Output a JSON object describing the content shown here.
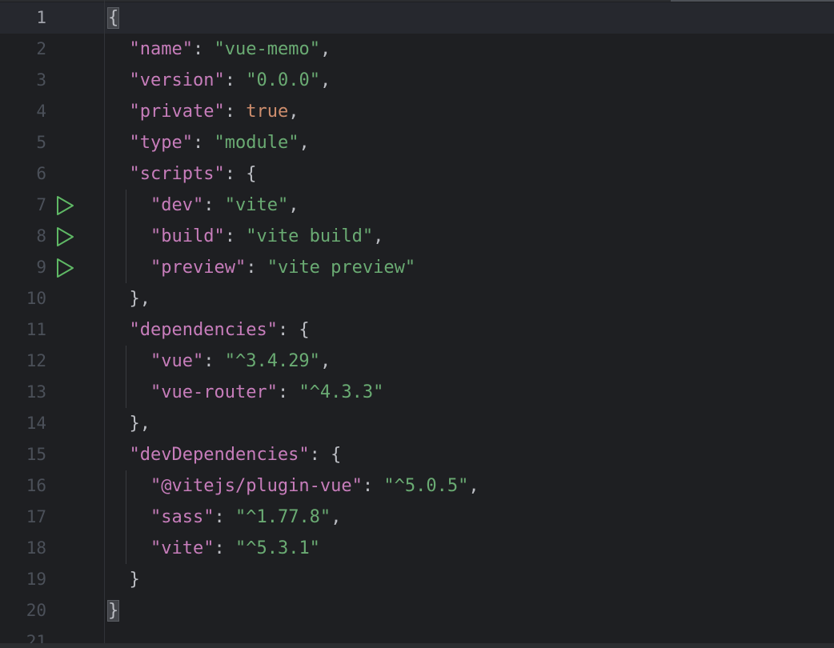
{
  "editor": {
    "active_line": 1,
    "lines": [
      {
        "n": "1",
        "tokens": [
          {
            "t": "brace",
            "v": "{"
          }
        ]
      },
      {
        "n": "2",
        "tokens": [
          {
            "t": "pun",
            "v": "  "
          },
          {
            "t": "key",
            "v": "\"name\""
          },
          {
            "t": "pun",
            "v": ": "
          },
          {
            "t": "str",
            "v": "\"vue-memo\""
          },
          {
            "t": "pun",
            "v": ","
          }
        ]
      },
      {
        "n": "3",
        "tokens": [
          {
            "t": "pun",
            "v": "  "
          },
          {
            "t": "key",
            "v": "\"version\""
          },
          {
            "t": "pun",
            "v": ": "
          },
          {
            "t": "str",
            "v": "\"0.0.0\""
          },
          {
            "t": "pun",
            "v": ","
          }
        ]
      },
      {
        "n": "4",
        "tokens": [
          {
            "t": "pun",
            "v": "  "
          },
          {
            "t": "key",
            "v": "\"private\""
          },
          {
            "t": "pun",
            "v": ": "
          },
          {
            "t": "kw",
            "v": "true"
          },
          {
            "t": "pun",
            "v": ","
          }
        ]
      },
      {
        "n": "5",
        "tokens": [
          {
            "t": "pun",
            "v": "  "
          },
          {
            "t": "key",
            "v": "\"type\""
          },
          {
            "t": "pun",
            "v": ": "
          },
          {
            "t": "str",
            "v": "\"module\""
          },
          {
            "t": "pun",
            "v": ","
          }
        ]
      },
      {
        "n": "6",
        "tokens": [
          {
            "t": "pun",
            "v": "  "
          },
          {
            "t": "key",
            "v": "\"scripts\""
          },
          {
            "t": "pun",
            "v": ": {"
          }
        ]
      },
      {
        "n": "7",
        "run": true,
        "tokens": [
          {
            "t": "pun",
            "v": "    "
          },
          {
            "t": "key",
            "v": "\"dev\""
          },
          {
            "t": "pun",
            "v": ": "
          },
          {
            "t": "str",
            "v": "\"vite\""
          },
          {
            "t": "pun",
            "v": ","
          }
        ]
      },
      {
        "n": "8",
        "run": true,
        "tokens": [
          {
            "t": "pun",
            "v": "    "
          },
          {
            "t": "key",
            "v": "\"build\""
          },
          {
            "t": "pun",
            "v": ": "
          },
          {
            "t": "str",
            "v": "\"vite build\""
          },
          {
            "t": "pun",
            "v": ","
          }
        ]
      },
      {
        "n": "9",
        "run": true,
        "tokens": [
          {
            "t": "pun",
            "v": "    "
          },
          {
            "t": "key",
            "v": "\"preview\""
          },
          {
            "t": "pun",
            "v": ": "
          },
          {
            "t": "str",
            "v": "\"vite preview\""
          }
        ]
      },
      {
        "n": "10",
        "tokens": [
          {
            "t": "pun",
            "v": "  },"
          }
        ]
      },
      {
        "n": "11",
        "tokens": [
          {
            "t": "pun",
            "v": "  "
          },
          {
            "t": "key",
            "v": "\"dependencies\""
          },
          {
            "t": "pun",
            "v": ": {"
          }
        ]
      },
      {
        "n": "12",
        "tokens": [
          {
            "t": "pun",
            "v": "    "
          },
          {
            "t": "key",
            "v": "\"vue\""
          },
          {
            "t": "pun",
            "v": ": "
          },
          {
            "t": "str",
            "v": "\"^3.4.29\""
          },
          {
            "t": "pun",
            "v": ","
          }
        ]
      },
      {
        "n": "13",
        "tokens": [
          {
            "t": "pun",
            "v": "    "
          },
          {
            "t": "key",
            "v": "\"vue-router\""
          },
          {
            "t": "pun",
            "v": ": "
          },
          {
            "t": "str",
            "v": "\"^4.3.3\""
          }
        ]
      },
      {
        "n": "14",
        "tokens": [
          {
            "t": "pun",
            "v": "  },"
          }
        ]
      },
      {
        "n": "15",
        "tokens": [
          {
            "t": "pun",
            "v": "  "
          },
          {
            "t": "key",
            "v": "\"devDependencies\""
          },
          {
            "t": "pun",
            "v": ": {"
          }
        ]
      },
      {
        "n": "16",
        "tokens": [
          {
            "t": "pun",
            "v": "    "
          },
          {
            "t": "key",
            "v": "\"@vitejs/plugin-vue\""
          },
          {
            "t": "pun",
            "v": ": "
          },
          {
            "t": "str",
            "v": "\"^5.0.5\""
          },
          {
            "t": "pun",
            "v": ","
          }
        ]
      },
      {
        "n": "17",
        "tokens": [
          {
            "t": "pun",
            "v": "    "
          },
          {
            "t": "key",
            "v": "\"sass\""
          },
          {
            "t": "pun",
            "v": ": "
          },
          {
            "t": "str",
            "v": "\"^1.77.8\""
          },
          {
            "t": "pun",
            "v": ","
          }
        ]
      },
      {
        "n": "18",
        "tokens": [
          {
            "t": "pun",
            "v": "    "
          },
          {
            "t": "key",
            "v": "\"vite\""
          },
          {
            "t": "pun",
            "v": ": "
          },
          {
            "t": "str",
            "v": "\"^5.3.1\""
          }
        ]
      },
      {
        "n": "19",
        "tokens": [
          {
            "t": "pun",
            "v": "  }"
          }
        ]
      },
      {
        "n": "20",
        "tokens": [
          {
            "t": "brace",
            "v": "}"
          }
        ]
      },
      {
        "n": "21",
        "tokens": []
      }
    ],
    "run_icon": "run-play-icon",
    "colors": {
      "background": "#1e1f22",
      "key": "#c77dbb",
      "string": "#6aab73",
      "keyword": "#cf8e6d",
      "punctuation": "#bcbec4",
      "run_icon": "#5fb865"
    }
  }
}
